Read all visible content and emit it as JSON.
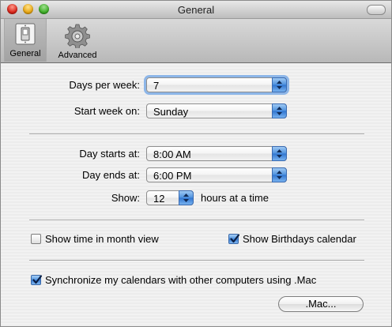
{
  "window": {
    "title": "General"
  },
  "toolbar": {
    "general_label": "General",
    "advanced_label": "Advanced"
  },
  "settings": {
    "days_per_week": {
      "label": "Days per week:",
      "value": "7"
    },
    "start_week_on": {
      "label": "Start week on:",
      "value": "Sunday"
    },
    "day_starts_at": {
      "label": "Day starts at:",
      "value": "8:00 AM"
    },
    "day_ends_at": {
      "label": "Day ends at:",
      "value": "6:00 PM"
    },
    "show": {
      "label": "Show:",
      "value": "12",
      "suffix": "hours at a time"
    }
  },
  "options": {
    "show_time_month": {
      "label": "Show time in month view",
      "checked": false
    },
    "show_birthdays": {
      "label": "Show Birthdays calendar",
      "checked": true
    },
    "sync": {
      "label": "Synchronize my calendars with other computers using .Mac",
      "checked": true
    }
  },
  "mac_button_label": ".Mac...",
  "colors": {
    "accent": "#3478d2",
    "window_bg": "#ececec"
  }
}
